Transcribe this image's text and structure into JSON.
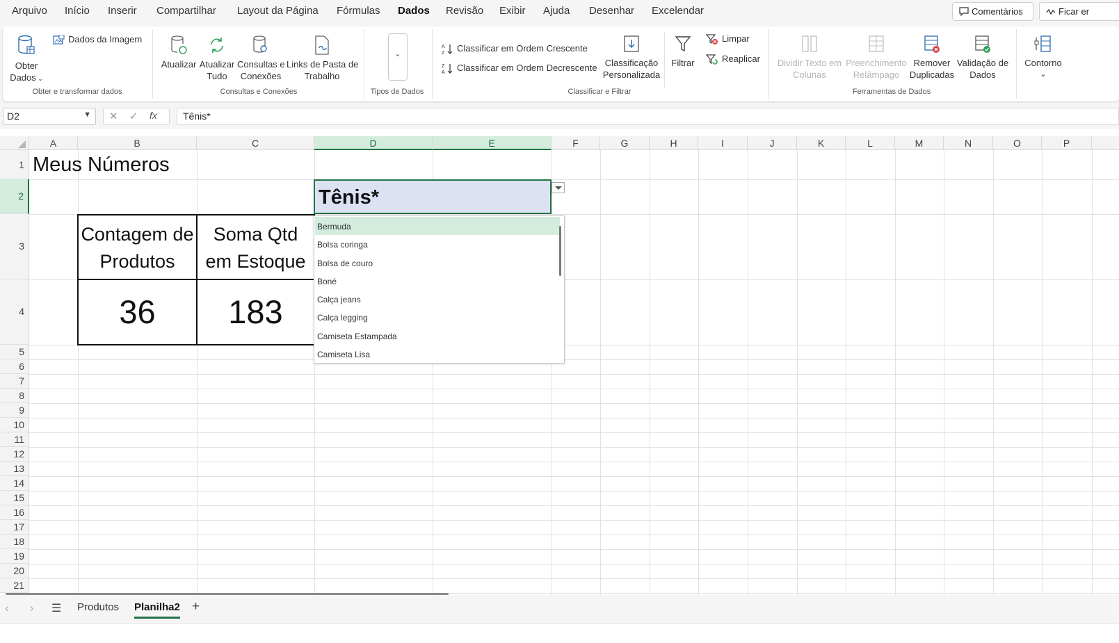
{
  "menu": {
    "items": [
      "Arquivo",
      "Início",
      "Inserir",
      "Compartilhar",
      "Layout da Página",
      "Fórmulas",
      "Dados",
      "Revisão",
      "Exibir",
      "Ajuda",
      "Desenhar",
      "Excelendar"
    ],
    "active": "Dados",
    "comments_label": "Comentários",
    "catchup_label": "Ficar er"
  },
  "ribbon": {
    "get_data": {
      "line1": "Obter",
      "line2": "Dados",
      "image_label": "Dados da Imagem",
      "group": "Obter e transformar dados"
    },
    "queries": {
      "refresh": "Atualizar",
      "refresh_all_1": "Atualizar",
      "refresh_all_2": "Tudo",
      "queries_1": "Consultas e",
      "queries_2": "Conexões",
      "links_1": "Links de Pasta de",
      "links_2": "Trabalho",
      "group": "Consultas e Conexões"
    },
    "data_types": {
      "group": "Tipos de Dados"
    },
    "sort": {
      "asc": "Classificar em Ordem Crescente",
      "desc": "Classificar em Ordem Decrescente",
      "custom_1": "Classificação",
      "custom_2": "Personalizada",
      "filter": "Filtrar",
      "clear": "Limpar",
      "reapply": "Reaplicar",
      "group": "Classificar e Filtrar"
    },
    "tools": {
      "split_1": "Dividir Texto em",
      "split_2": "Colunas",
      "flash_1": "Preenchimento",
      "flash_2": "Relâmpago",
      "dup_1": "Remover",
      "dup_2": "Duplicadas",
      "valid_1": "Validação de",
      "valid_2": "Dados",
      "group": "Ferramentas de Dados"
    },
    "outline": {
      "label": "Contorno"
    }
  },
  "formula_bar": {
    "name_box": "D2",
    "fx": "fx",
    "formula": "Tênis*"
  },
  "grid": {
    "columns": [
      "A",
      "B",
      "C",
      "D",
      "E",
      "F",
      "G",
      "H",
      "I",
      "J",
      "K",
      "L",
      "M",
      "N",
      "O",
      "P"
    ],
    "rows": [
      "1",
      "2",
      "3",
      "4",
      "5",
      "6",
      "7",
      "8",
      "9",
      "10",
      "11",
      "12",
      "13",
      "14",
      "15",
      "16",
      "17",
      "18",
      "19",
      "20",
      "21"
    ],
    "title": "Meus Números",
    "d2_value": "Tênis*",
    "kpi1": {
      "head_1": "Contagem de",
      "head_2": "Produtos",
      "value": "36"
    },
    "kpi2": {
      "head_1": "Soma Qtd",
      "head_2": "em Estoque",
      "value": "183"
    }
  },
  "dropdown": {
    "options": [
      "Bermuda",
      "Bolsa coringa",
      "Bolsa de couro",
      "Boné",
      "Calça jeans",
      "Calça legging",
      "Camiseta Estampada",
      "Camiseta Lisa"
    ],
    "highlighted": "Bermuda"
  },
  "sheets": {
    "tabs": [
      "Produtos",
      "Planilha2"
    ],
    "active": "Planilha2"
  },
  "colors": {
    "accent": "#217346",
    "selection": "#d3ecdd",
    "d2_fill": "#dde2f3"
  }
}
